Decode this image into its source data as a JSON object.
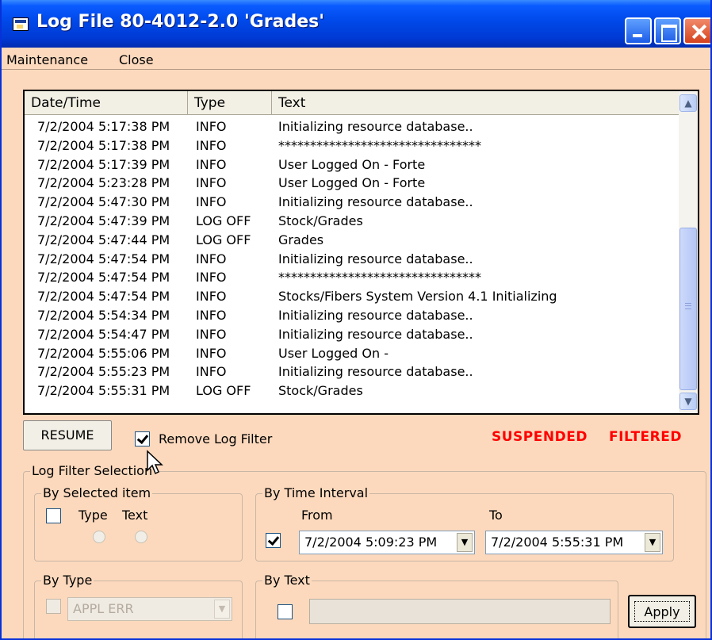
{
  "window": {
    "title": "Log File 80-4012-2.0 'Grades'"
  },
  "menu": {
    "items": [
      "Maintenance",
      "Close"
    ]
  },
  "log": {
    "columns": [
      "Date/Time",
      "Type",
      "Text"
    ],
    "rows": [
      {
        "datetime": "7/2/2004 5:17:38 PM",
        "type": "INFO",
        "text": "Initializing resource database.."
      },
      {
        "datetime": "7/2/2004 5:17:38 PM",
        "type": "INFO",
        "text": "********************************"
      },
      {
        "datetime": "7/2/2004 5:17:39 PM",
        "type": "INFO",
        "text": "User Logged On - Forte"
      },
      {
        "datetime": "7/2/2004 5:23:28 PM",
        "type": "INFO",
        "text": "User Logged On - Forte"
      },
      {
        "datetime": "7/2/2004 5:47:30 PM",
        "type": "INFO",
        "text": "Initializing resource database.."
      },
      {
        "datetime": "7/2/2004 5:47:39 PM",
        "type": "LOG OFF",
        "text": "Stock/Grades"
      },
      {
        "datetime": "7/2/2004 5:47:44 PM",
        "type": "LOG OFF",
        "text": "Grades"
      },
      {
        "datetime": "7/2/2004 5:47:54 PM",
        "type": "INFO",
        "text": "Initializing resource database.."
      },
      {
        "datetime": "7/2/2004 5:47:54 PM",
        "type": "INFO",
        "text": "********************************"
      },
      {
        "datetime": "7/2/2004 5:47:54 PM",
        "type": "INFO",
        "text": "Stocks/Fibers System Version 4.1 Initializing"
      },
      {
        "datetime": "7/2/2004 5:54:34 PM",
        "type": "INFO",
        "text": "Initializing resource database.."
      },
      {
        "datetime": "7/2/2004 5:54:47 PM",
        "type": "INFO",
        "text": "Initializing resource database.."
      },
      {
        "datetime": "7/2/2004 5:55:06 PM",
        "type": "INFO",
        "text": "User Logged On -"
      },
      {
        "datetime": "7/2/2004 5:55:23 PM",
        "type": "INFO",
        "text": "Initializing resource database.."
      },
      {
        "datetime": "7/2/2004 5:55:31 PM",
        "type": "LOG OFF",
        "text": "Stock/Grades"
      }
    ]
  },
  "controls": {
    "resume_label": "RESUME",
    "remove_filter_label": "Remove Log Filter",
    "remove_filter_checked": true,
    "status_suspended": "SUSPENDED",
    "status_filtered": "FILTERED"
  },
  "filter": {
    "group_title": "Log Filter Selection",
    "by_selected": {
      "title": "By Selected item",
      "checked": false,
      "type_label": "Type",
      "text_label": "Text"
    },
    "by_time": {
      "title": "By Time Interval",
      "checked": true,
      "from_label": "From",
      "to_label": "To",
      "from_value": "7/2/2004 5:09:23 PM",
      "to_value": "7/2/2004 5:55:31 PM"
    },
    "by_type": {
      "title": "By Type",
      "checked": false,
      "value": "APPL ERR"
    },
    "by_text": {
      "title": "By Text",
      "checked": false,
      "value": ""
    },
    "apply_label": "Apply"
  },
  "colors": {
    "window_bg": "#fcd9bd",
    "titlebar": "#0048e8",
    "status_red": "#ff0000"
  }
}
